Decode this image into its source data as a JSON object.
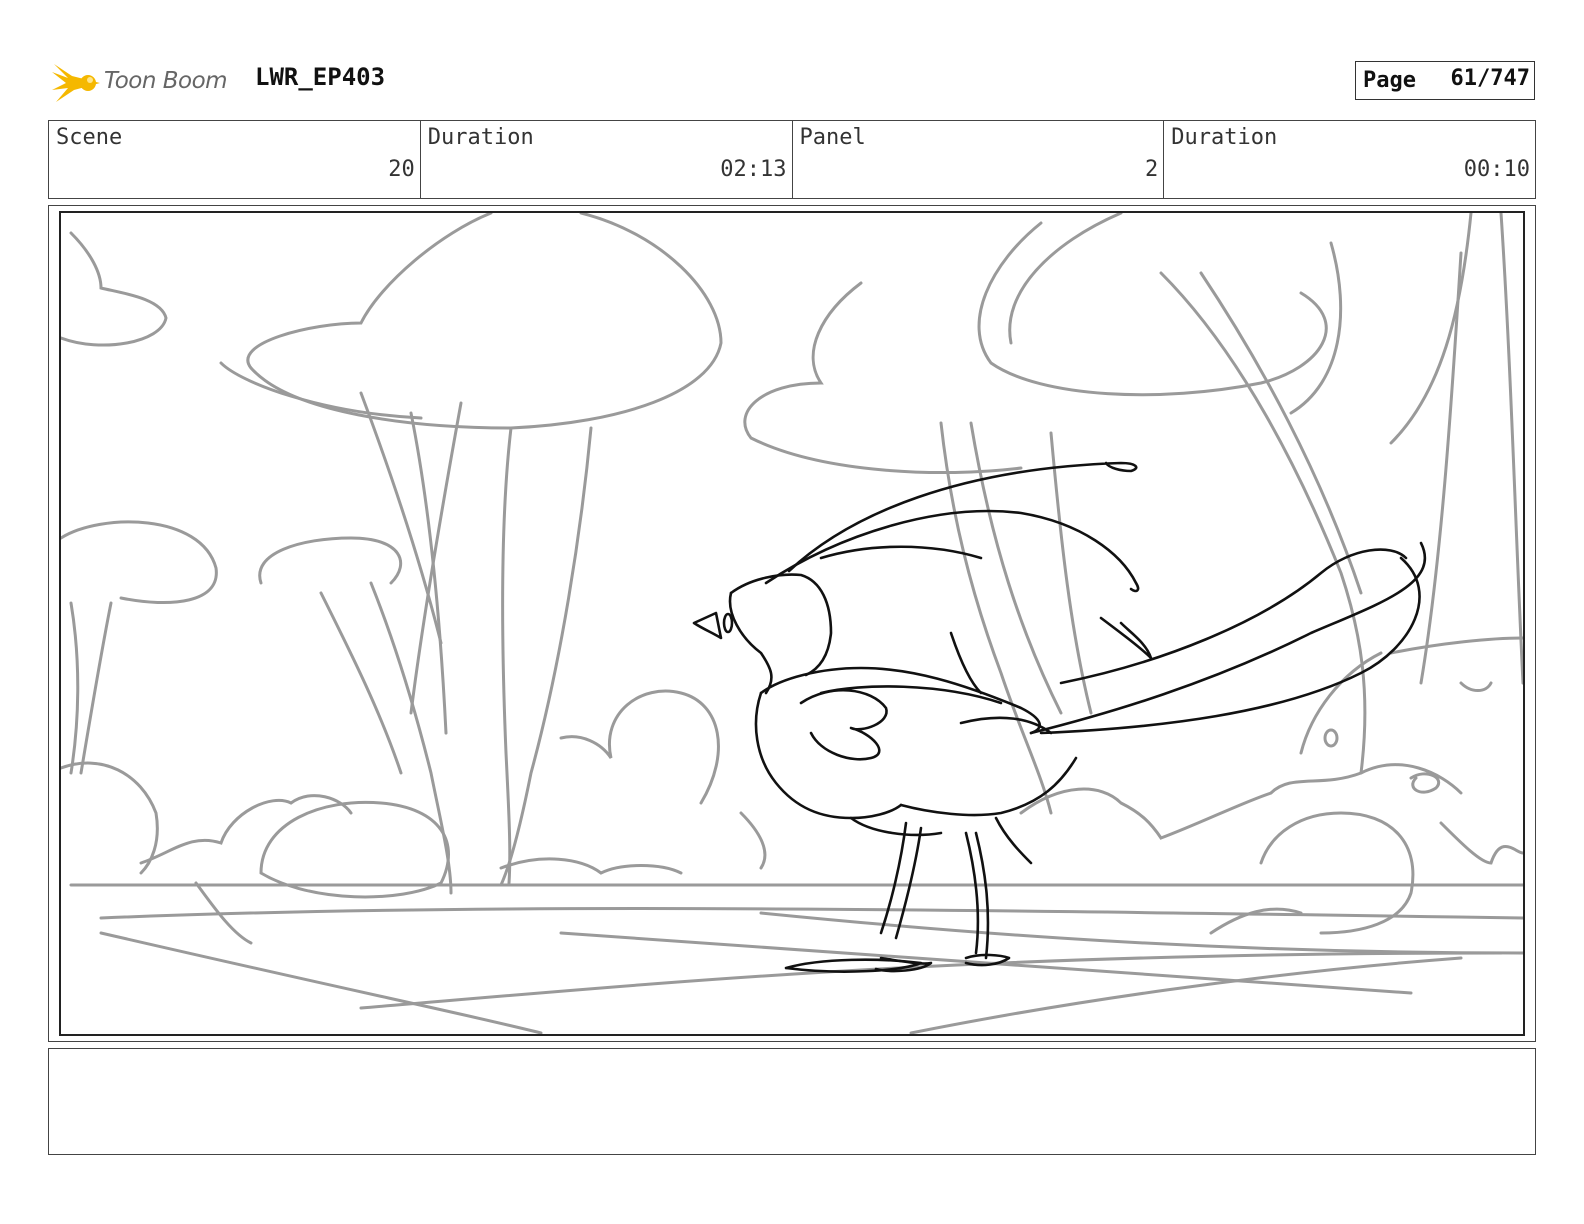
{
  "header": {
    "logo_text": "Toon Boom",
    "project": "LWR_EP403",
    "page_label": "Page",
    "page_value": "61/747"
  },
  "info": {
    "scene_label": "Scene",
    "scene_value": "20",
    "duration_label": "Duration",
    "duration_value": "02:13",
    "panel_label": "Panel",
    "panel_value": "2",
    "panel_duration_label": "Duration",
    "panel_duration_value": "00:10"
  },
  "panel": {
    "description": ""
  },
  "colors": {
    "logo_star": "#f5b800",
    "sketch_bg": "#9a9a9a",
    "sketch_fg": "#111111"
  }
}
